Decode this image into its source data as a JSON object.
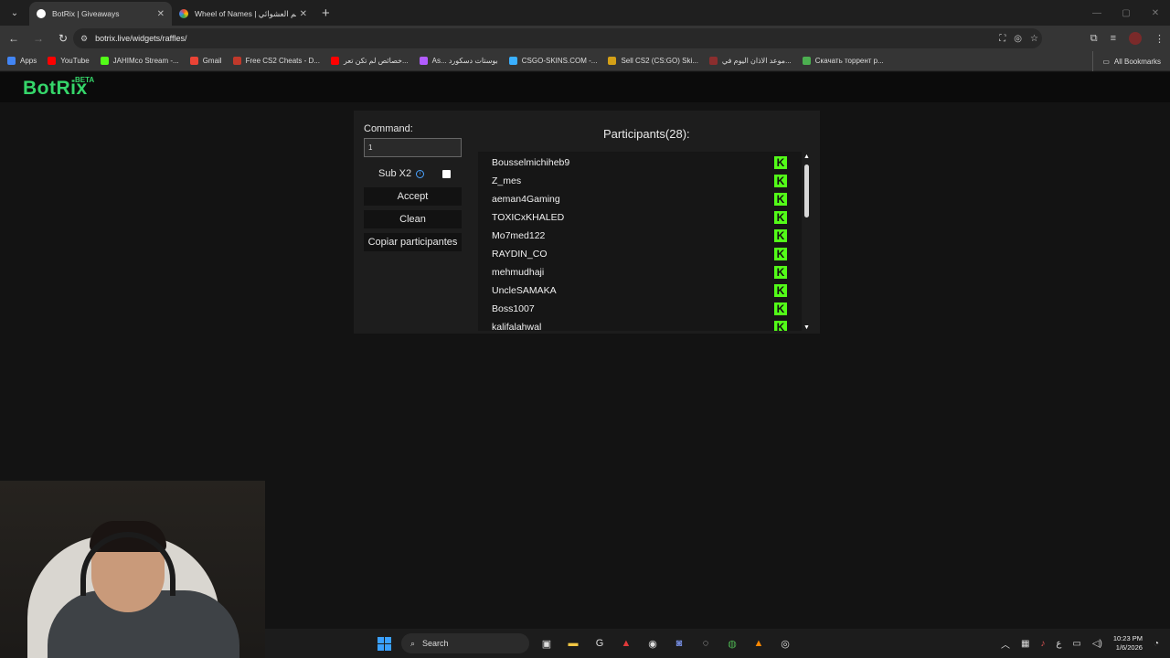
{
  "browser": {
    "tabs": [
      {
        "title": "BotRix | Giveaways",
        "active": true,
        "favicon_color": "#ffffff"
      },
      {
        "title": "Wheel of Names | سم العشوائي",
        "active": false,
        "favicon_color": "#e94b3c"
      }
    ],
    "new_tab": "+",
    "url": "botrix.live/widgets/raffles/",
    "bookmarks": [
      {
        "label": "Apps",
        "color": "#4285f4"
      },
      {
        "label": "YouTube",
        "color": "#ff0000"
      },
      {
        "label": "JAHIMco Stream -...",
        "color": "#53fc18"
      },
      {
        "label": "Gmail",
        "color": "#ea4335"
      },
      {
        "label": "Free CS2 Cheats - D...",
        "color": "#c0392b"
      },
      {
        "label": "خصائص لم تكن تعر...",
        "color": "#ff0000"
      },
      {
        "label": "As... بوستات دسكورد",
        "color": "#b25cff"
      },
      {
        "label": "CSGO-SKINS.COM -...",
        "color": "#3ab0ff"
      },
      {
        "label": "Sell CS2 (CS:GO) Ski...",
        "color": "#d4a017"
      },
      {
        "label": "موعد الاذان اليوم في...",
        "color": "#8b2e2e"
      },
      {
        "label": "Скачать торрент р...",
        "color": "#4caf50"
      }
    ],
    "all_bookmarks": "All Bookmarks"
  },
  "site": {
    "logo": "BotRix",
    "beta": "BETA"
  },
  "raffle": {
    "command_label": "Command:",
    "command_value": "1",
    "sub_x2_label": "Sub X2",
    "sub_x2_checked": false,
    "accept_label": "Accept",
    "clean_label": "Clean",
    "copy_label": "Copiar participantes",
    "participants_title": "Participants(28):",
    "participants": [
      "Bousselmichiheb9",
      "Z_mes",
      "aeman4Gaming",
      "TOXICxKHALED",
      "Mo7med122",
      "RAYDIN_CO",
      "mehmudhaji",
      "UncleSAMAKA",
      "Boss1007",
      "kalifalahwal"
    ],
    "platform_icon": "kick-icon",
    "platform_glyph": "K",
    "accent_color": "#53fc18"
  },
  "taskbar": {
    "search_label": "Search",
    "time": "10:23 PM",
    "date": "1/6/2026",
    "lang": "ع"
  }
}
